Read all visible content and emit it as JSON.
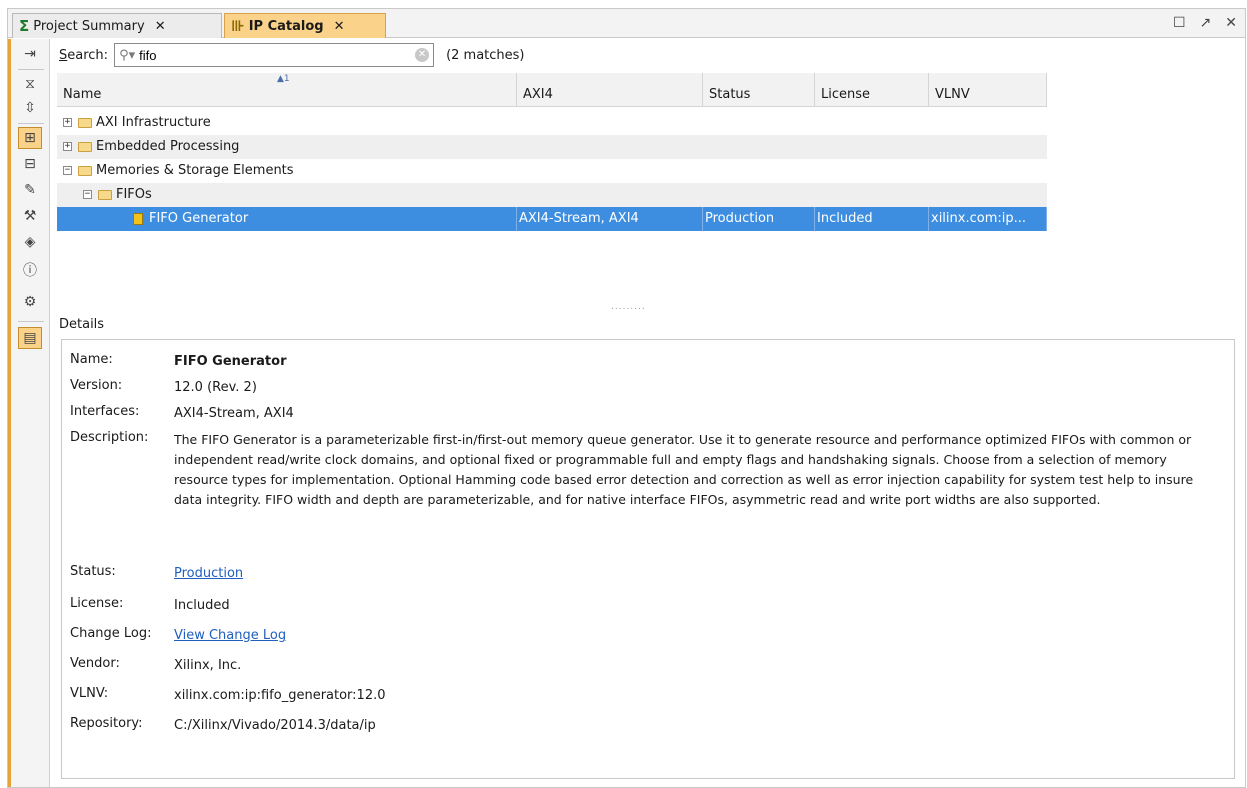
{
  "tabs": [
    {
      "label": "Project Summary",
      "icon": "sigma-icon"
    },
    {
      "label": "IP Catalog",
      "icon": "ip-catalog-icon"
    }
  ],
  "search": {
    "label_prefix": "S",
    "label_rest": "earch:",
    "value": "fifo",
    "match_count": "(2 matches)"
  },
  "table": {
    "columns": [
      "Name",
      "AXI4",
      "Status",
      "License",
      "VLNV"
    ],
    "sort_indicator": "▲1",
    "rows": [
      {
        "name": "AXI Infrastructure",
        "expander": "+",
        "axi4": "",
        "status": "",
        "license": "",
        "vlnv": ""
      },
      {
        "name": "Embedded Processing",
        "expander": "+",
        "axi4": "",
        "status": "",
        "license": "",
        "vlnv": ""
      },
      {
        "name": "Memories & Storage Elements",
        "expander": "−",
        "axi4": "",
        "status": "",
        "license": "",
        "vlnv": ""
      },
      {
        "name": "FIFOs",
        "expander": "−",
        "axi4": "",
        "status": "",
        "license": "",
        "vlnv": ""
      },
      {
        "name": "FIFO Generator",
        "expander": "",
        "axi4": "AXI4-Stream, AXI4",
        "status": "Production",
        "license": "Included",
        "vlnv": "xilinx.com:ip..."
      }
    ]
  },
  "details": {
    "title": "Details",
    "name_label": "Name:",
    "name_value": "FIFO Generator",
    "version_label": "Version:",
    "version_value": "12.0 (Rev. 2)",
    "interfaces_label": "Interfaces:",
    "interfaces_value": "AXI4-Stream, AXI4",
    "description_label": "Description:",
    "description_value": "The FIFO Generator is a parameterizable first-in/first-out memory queue generator. Use it to generate resource and performance optimized FIFOs with common or independent read/write clock domains, and optional fixed or programmable full and empty flags and handshaking signals.  Choose from a selection of memory resource types for implementation.  Optional Hamming code based error detection and correction as well as error injection capability for system test help to insure data integrity.  FIFO width and depth are parameterizable, and for native interface FIFOs, asymmetric read and write port widths are also supported.",
    "status_label": "Status:",
    "status_value": "Production",
    "license_label": "License:",
    "license_value": "Included",
    "changelog_label": "Change Log:",
    "changelog_value": "View Change Log",
    "vendor_label": "Vendor:",
    "vendor_value": "Xilinx, Inc.",
    "vlnv_label": "VLNV:",
    "vlnv_value": "xilinx.com:ip:fifo_generator:12.0",
    "repository_label": "Repository:",
    "repository_value": "C:/Xilinx/Vivado/2014.3/data/ip"
  },
  "colors": {
    "active_tab": "#fbd28a",
    "selection": "#3d8ee0",
    "link": "#1f5fbf"
  }
}
